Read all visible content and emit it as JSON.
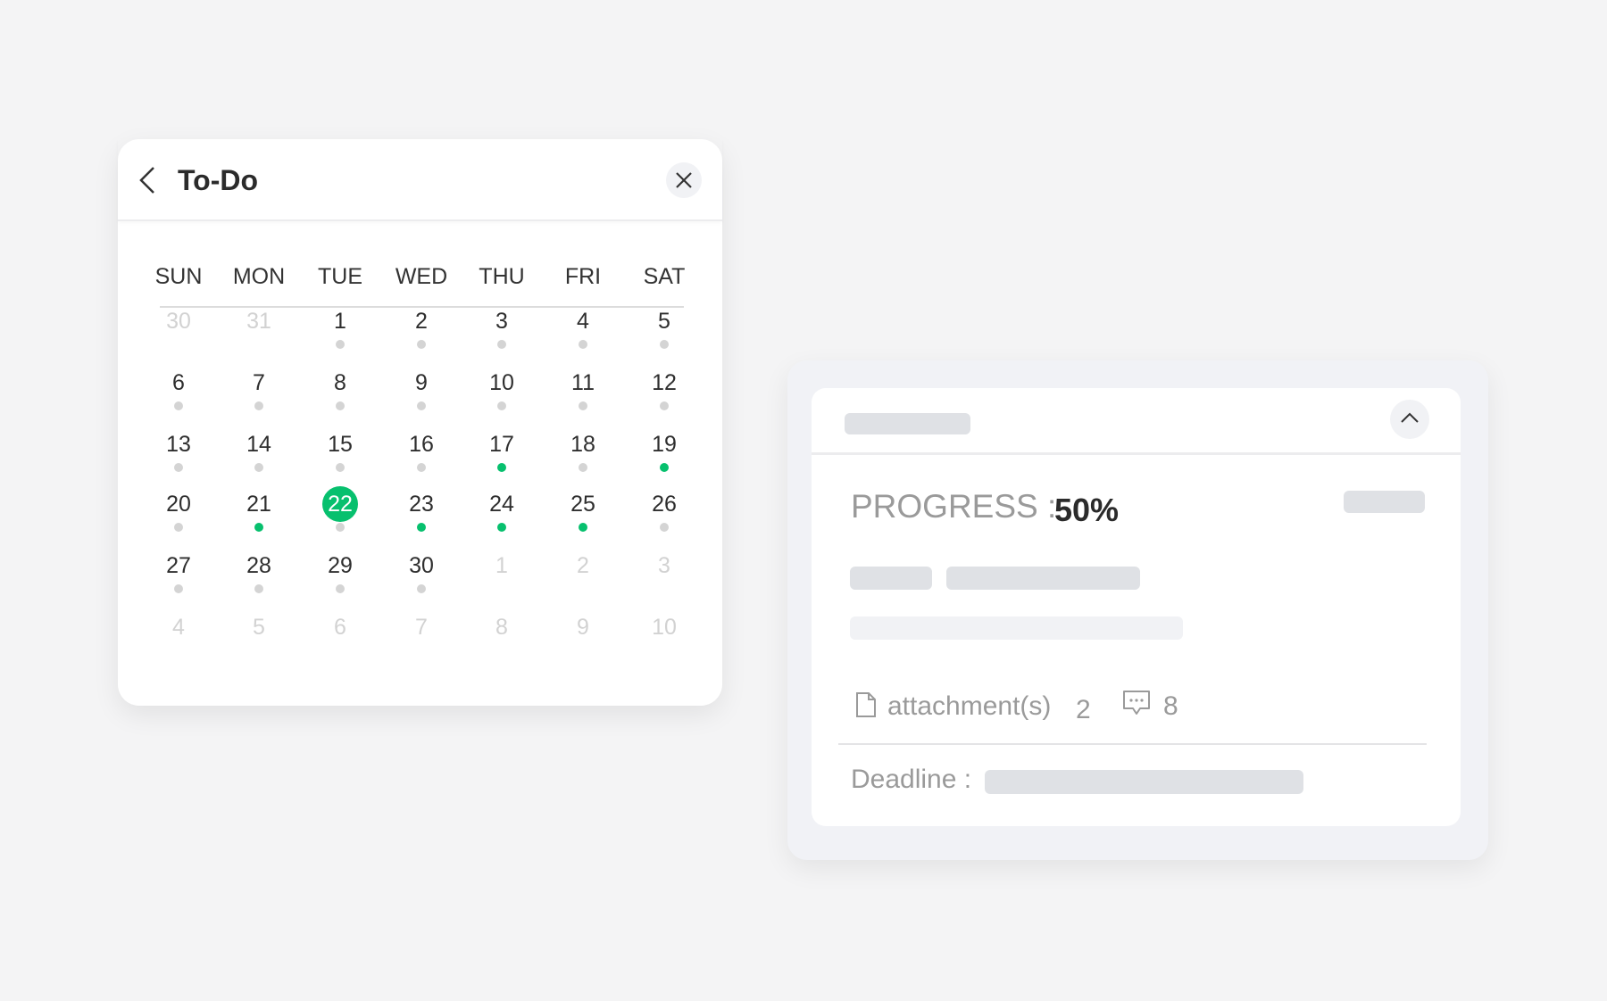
{
  "calendar": {
    "title": "To-Do",
    "weekdays": [
      "SUN",
      "MON",
      "TUE",
      "WED",
      "THU",
      "FRI",
      "SAT"
    ],
    "colors": {
      "accent": "#07c06e",
      "dot_default": "#d4d4d4"
    },
    "weeks": [
      [
        {
          "d": "30",
          "muted": true
        },
        {
          "d": "31",
          "muted": true
        },
        {
          "d": "1",
          "dot": "gray"
        },
        {
          "d": "2",
          "dot": "gray"
        },
        {
          "d": "3",
          "dot": "gray"
        },
        {
          "d": "4",
          "dot": "gray"
        },
        {
          "d": "5",
          "dot": "gray"
        }
      ],
      [
        {
          "d": "6",
          "dot": "gray"
        },
        {
          "d": "7",
          "dot": "gray"
        },
        {
          "d": "8",
          "dot": "gray"
        },
        {
          "d": "9",
          "dot": "gray"
        },
        {
          "d": "10",
          "dot": "gray"
        },
        {
          "d": "11",
          "dot": "gray"
        },
        {
          "d": "12",
          "dot": "gray"
        }
      ],
      [
        {
          "d": "13",
          "dot": "gray"
        },
        {
          "d": "14",
          "dot": "gray"
        },
        {
          "d": "15",
          "dot": "gray"
        },
        {
          "d": "16",
          "dot": "gray"
        },
        {
          "d": "17",
          "dot": "green"
        },
        {
          "d": "18",
          "dot": "gray"
        },
        {
          "d": "19",
          "dot": "green"
        }
      ],
      [
        {
          "d": "20",
          "dot": "gray"
        },
        {
          "d": "21",
          "dot": "green"
        },
        {
          "d": "22",
          "dot": "gray",
          "selected": true
        },
        {
          "d": "23",
          "dot": "green"
        },
        {
          "d": "24",
          "dot": "green"
        },
        {
          "d": "25",
          "dot": "green"
        },
        {
          "d": "26",
          "dot": "gray"
        }
      ],
      [
        {
          "d": "27",
          "dot": "gray"
        },
        {
          "d": "28",
          "dot": "gray"
        },
        {
          "d": "29",
          "dot": "gray"
        },
        {
          "d": "30",
          "dot": "gray"
        },
        {
          "d": "1",
          "muted": true
        },
        {
          "d": "2",
          "muted": true
        },
        {
          "d": "3",
          "muted": true
        }
      ],
      [
        {
          "d": "4",
          "muted": true
        },
        {
          "d": "5",
          "muted": true
        },
        {
          "d": "6",
          "muted": true
        },
        {
          "d": "7",
          "muted": true
        },
        {
          "d": "8",
          "muted": true
        },
        {
          "d": "9",
          "muted": true
        },
        {
          "d": "10",
          "muted": true
        }
      ]
    ]
  },
  "task": {
    "progress_label": "PROGRESS :",
    "progress_value": "50%",
    "progress_percent": 50,
    "attachments_label": "attachment(s)",
    "attachments_count": "2",
    "comments_count": "8",
    "deadline_label": "Deadline :"
  }
}
